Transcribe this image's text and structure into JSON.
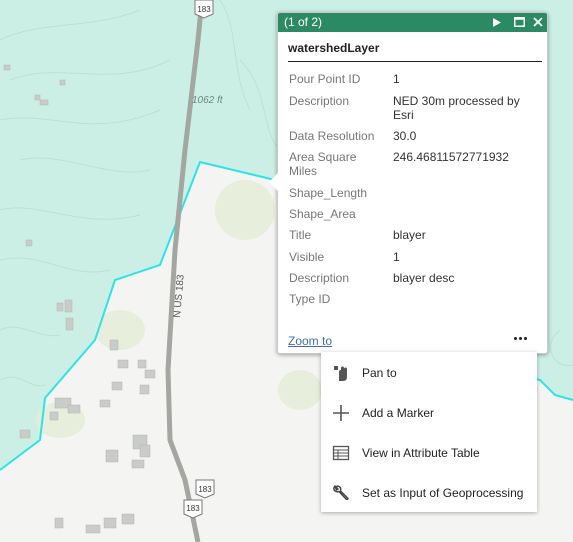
{
  "map": {
    "elevation_label": "1062 ft",
    "road_label": "N US 183",
    "shield_label": "183",
    "colors": {
      "watershed_fill": "#ccefe5",
      "watershed_outline": "#2de3e8",
      "road": "#a3a6a1",
      "land": "#f4f5f2"
    }
  },
  "popup": {
    "count": "(1 of 2)",
    "layer_title": "watershedLayer",
    "attributes": [
      {
        "name": "Pour Point ID",
        "value": "1"
      },
      {
        "name": "Description",
        "value": "NED 30m processed by Esri"
      },
      {
        "name": "Data Resolution",
        "value": "30.0"
      },
      {
        "name": "Area Square Miles",
        "value": "246.46811572771932"
      },
      {
        "name": "Shape_Length",
        "value": ""
      },
      {
        "name": "Shape_Area",
        "value": ""
      },
      {
        "name": "Title",
        "value": "blayer"
      },
      {
        "name": "Visible",
        "value": "1"
      },
      {
        "name": "Description",
        "value": "blayer desc"
      },
      {
        "name": "Type ID",
        "value": ""
      }
    ],
    "zoom_link": "Zoom to",
    "header_color": "#2b8a64"
  },
  "menu": {
    "items": [
      {
        "label": "Pan to",
        "icon": "pan-hand-icon"
      },
      {
        "label": "Add a Marker",
        "icon": "plus-icon"
      },
      {
        "label": "View in Attribute Table",
        "icon": "table-icon"
      },
      {
        "label": "Set as Input of Geoprocessing",
        "icon": "wrench-icon"
      }
    ]
  }
}
